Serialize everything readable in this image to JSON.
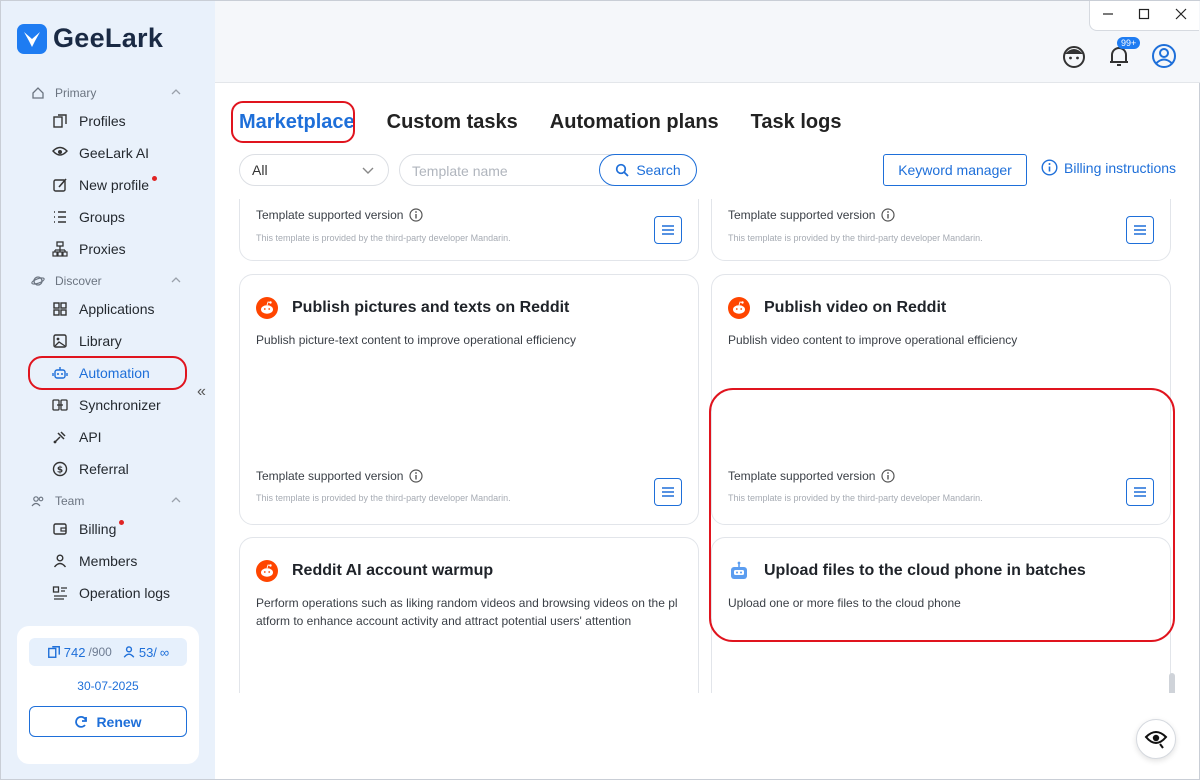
{
  "app": {
    "name": "GeeLark"
  },
  "sidebar": {
    "sections": [
      {
        "label": "Primary",
        "items": [
          {
            "label": "Profiles",
            "icon": "profiles-icon"
          },
          {
            "label": "GeeLark AI",
            "icon": "ai-eye-icon"
          },
          {
            "label": "New profile",
            "icon": "edit-icon",
            "dot": true
          },
          {
            "label": "Groups",
            "icon": "list-icon"
          },
          {
            "label": "Proxies",
            "icon": "network-icon"
          }
        ]
      },
      {
        "label": "Discover",
        "items": [
          {
            "label": "Applications",
            "icon": "grid-icon"
          },
          {
            "label": "Library",
            "icon": "image-icon"
          },
          {
            "label": "Automation",
            "icon": "robot-icon",
            "active": true
          },
          {
            "label": "Synchronizer",
            "icon": "sync-icon"
          },
          {
            "label": "API",
            "icon": "api-icon"
          },
          {
            "label": "Referral",
            "icon": "dollar-icon"
          }
        ]
      },
      {
        "label": "Team",
        "items": [
          {
            "label": "Billing",
            "icon": "wallet-icon",
            "dot": true
          },
          {
            "label": "Members",
            "icon": "user-icon"
          },
          {
            "label": "Operation logs",
            "icon": "log-icon"
          }
        ]
      }
    ],
    "quota": {
      "profiles_used": "742",
      "profiles_total": "/900",
      "members_used": "53/",
      "members_total": "∞",
      "expiry": "30-07-2025",
      "renew_label": "Renew"
    }
  },
  "header": {
    "notification_badge": "99+"
  },
  "tabs": [
    "Marketplace",
    "Custom tasks",
    "Automation plans",
    "Task logs"
  ],
  "filters": {
    "category": "All",
    "search_placeholder": "Template name",
    "search_label": "Search",
    "keyword_manager": "Keyword manager",
    "billing_instructions": "Billing instructions"
  },
  "cards": [
    {
      "title": "",
      "description": "",
      "version_label": "Template supported version",
      "provider": "This template is provided by the third-party developer Mandarin."
    },
    {
      "title": "",
      "description": "",
      "version_label": "Template supported version",
      "provider": "This template is provided by the third-party developer Mandarin."
    },
    {
      "title": "Publish pictures and texts on Reddit",
      "description": "Publish picture-text content to improve operational efficiency",
      "version_label": "Template supported version",
      "provider": "This template is provided by the third-party developer Mandarin.",
      "icon": "reddit-icon"
    },
    {
      "title": "Publish video on Reddit",
      "description": "Publish video content to improve operational efficiency",
      "version_label": "Template supported version",
      "provider": "This template is provided by the third-party developer Mandarin.",
      "icon": "reddit-icon"
    },
    {
      "title": "Reddit AI account warmup",
      "description": "Perform operations such as liking random videos and browsing videos on the pl atform to enhance account activity and attract potential users' attention",
      "icon": "reddit-icon"
    },
    {
      "title": "Upload files to the cloud phone in batches",
      "description": "Upload one or more files to the cloud phone",
      "icon": "robot-icon"
    }
  ],
  "colors": {
    "accent": "#1e6fd9",
    "highlight": "#e0141e",
    "reddit": "#ff4500"
  }
}
